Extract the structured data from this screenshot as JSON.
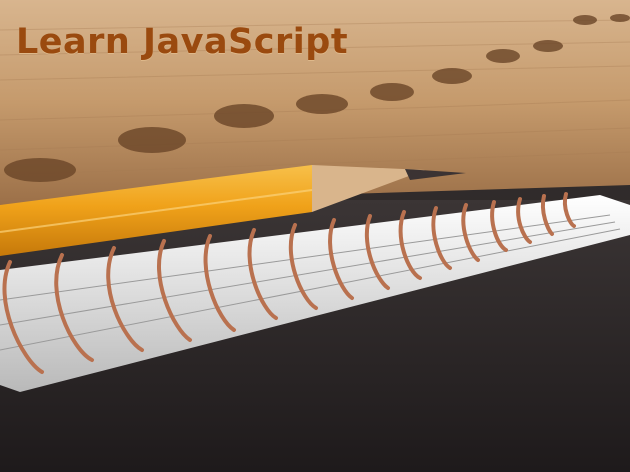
{
  "title": "Learn JavaScript",
  "colors": {
    "title": "#9a4a0f",
    "book_wood": "#c9a27a",
    "pencil_body": "#f0a21a",
    "pencil_tip": "#d9b58c",
    "spiral": "#b9714f",
    "paper": "#e8e8e8",
    "table": "#2b2627"
  },
  "icons": [
    "book",
    "pencil",
    "spiral-notebook"
  ]
}
